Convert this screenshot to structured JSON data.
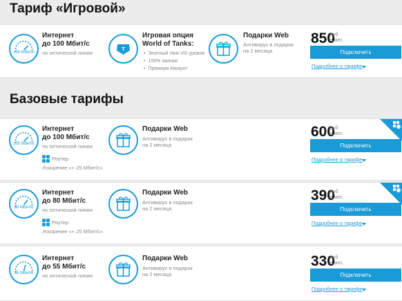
{
  "game": {
    "title": "Тариф «Игровой»",
    "internet_title_1": "Интернет",
    "internet_title_2": "до 100 Мбит/с",
    "internet_sub": "по оптической линии",
    "speed": "100 Мбит/с",
    "option_title_1": "Игровая опция",
    "option_title_2": "World of Tanks:",
    "option_bullets": [
      "Элитный танк VIII уровня",
      "100% экипаж",
      "Премиум Аккаунт"
    ],
    "gift_title": "Подарки Web",
    "gift_sub_1": "Антивирус в подарок",
    "gift_sub_2": "на 2 месяца",
    "price": "850",
    "rub": "руб",
    "per": "в мес.",
    "button": "Подключить",
    "more": "Подробнее о тарифе"
  },
  "base": {
    "title": "Базовые тарифы",
    "tariffs": [
      {
        "internet_title_1": "Интернет",
        "internet_title_2": "до 100 Мбит/с",
        "internet_sub": "по оптической линии",
        "speed": "100 Мбит/с",
        "router": "Роутер",
        "accel": "Ускорение «+ 25 Мбит/с»",
        "gift_title": "Подарки Web",
        "gift_sub_1": "Антивирус в подарок",
        "gift_sub_2": "на 2 месяца",
        "price": "600",
        "rub": "руб",
        "per": "в мес.",
        "button": "Подключить",
        "more": "Подробнее о тарифе"
      },
      {
        "internet_title_1": "Интернет",
        "internet_title_2": "до 80 Мбит/с",
        "internet_sub": "по оптической линии",
        "speed": "80 Мбит/с",
        "router": "Роутер",
        "accel": "Ускорение «+ 25 Мбит/с»",
        "gift_title": "Подарки Web",
        "gift_sub_1": "Антивирус в подарок",
        "gift_sub_2": "на 2 месяца",
        "price": "390",
        "rub": "руб",
        "per": "в мес.",
        "button": "Подключить",
        "more": "Подробнее о тарифе"
      },
      {
        "internet_title_1": "Интернет",
        "internet_title_2": "до 55 Мбит/с",
        "internet_sub": "по оптической линии",
        "speed": "55 Мбит/с",
        "gift_title": "Подарки Web",
        "gift_sub_1": "Антивирус в подарок",
        "gift_sub_2": "на 2 месяца",
        "price": "330",
        "rub": "руб",
        "per": "в мес.",
        "button": "Подключить",
        "more": "Подробнее о тарифе"
      }
    ]
  },
  "colors": {
    "accent": "#1a9ad6",
    "background": "#ececec",
    "card": "#ffffff"
  },
  "icons": [
    "speedometer-icon",
    "tank-icon",
    "gift-icon",
    "router-icon",
    "chevron-down-icon",
    "discount-corner-icon"
  ]
}
